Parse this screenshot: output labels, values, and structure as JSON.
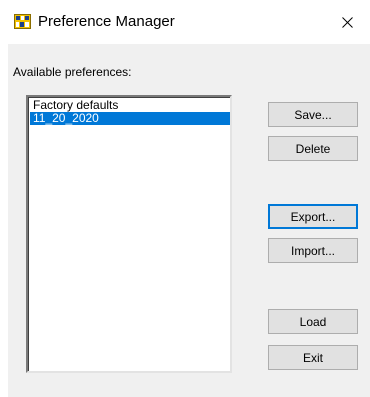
{
  "window": {
    "title": "Preference Manager"
  },
  "dialog": {
    "available_label": "Available preferences:",
    "preferences": [
      {
        "label": "Factory defaults",
        "selected": false
      },
      {
        "label": "11_20_2020",
        "selected": true
      }
    ],
    "buttons": {
      "save": "Save...",
      "delete": "Delete",
      "export": "Export...",
      "import": "Import...",
      "load": "Load",
      "exit": "Exit"
    }
  },
  "colors": {
    "selection": "#0078d7",
    "dialog_bg": "#f0f0f0",
    "button_bg": "#e1e1e1"
  },
  "icons": {
    "app": "preference-manager-icon",
    "close": "close-icon"
  }
}
